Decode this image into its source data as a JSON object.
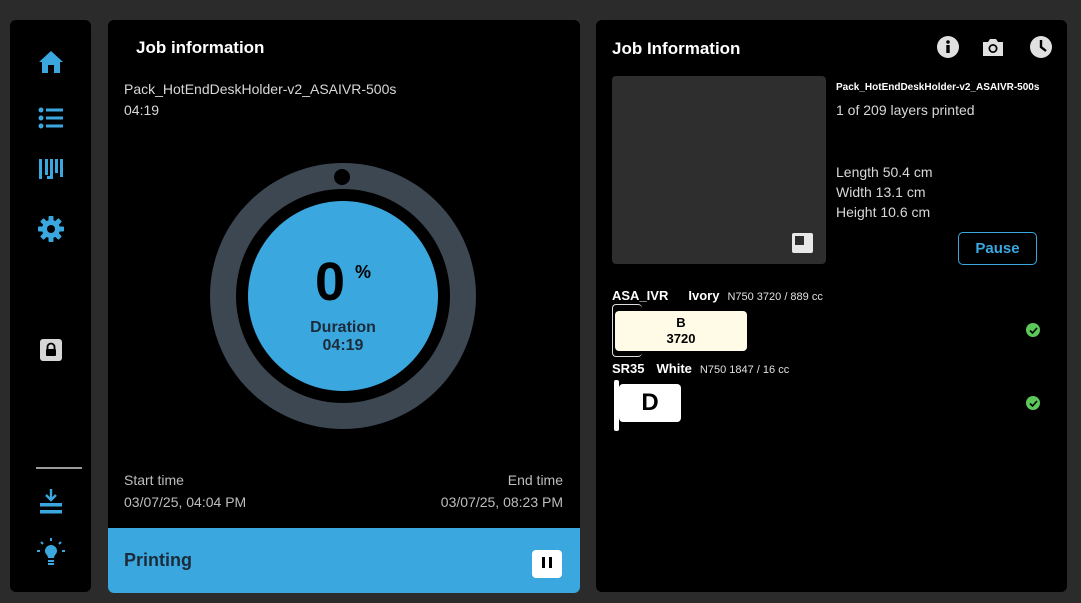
{
  "sidebar": {
    "items": [
      {
        "icon": "home-icon"
      },
      {
        "icon": "list-icon"
      },
      {
        "icon": "material-icon"
      },
      {
        "icon": "gear-icon"
      },
      {
        "icon": "lock-icon"
      },
      {
        "icon": "unload-icon"
      },
      {
        "icon": "lightbulb-icon"
      }
    ]
  },
  "left": {
    "title": "Job information",
    "file_name": "Pack_HotEndDeskHolder-v2_ASAIVR-500s",
    "elapsed": "04:19",
    "progress_value": "0",
    "progress_unit": "%",
    "progress_fraction": 0,
    "duration_label": "Duration",
    "duration_value": "04:19",
    "start_label": "Start time",
    "start_value": "03/07/25, 04:04 PM",
    "end_label": "End time",
    "end_value": "03/07/25, 08:23 PM",
    "status": "Printing"
  },
  "right": {
    "title": "Job Information",
    "file_name": "Pack_HotEndDeskHolder-v2_ASAIVR-500s",
    "layers": "1 of 209 layers printed",
    "length": "Length 50.4 cm",
    "width": "Width 13.1 cm",
    "height": "Height 10.6 cm",
    "pause_label": "Pause",
    "materials": [
      {
        "name": "ASA_IVR",
        "color": "Ivory",
        "detail": "N750 3720 / 889 cc",
        "slot": "B",
        "code": "3720"
      },
      {
        "name": "SR35",
        "color": "White",
        "detail": "N750 1847 / 16 cc",
        "slot": "D"
      }
    ]
  },
  "colors": {
    "accent": "#3aa8df",
    "ring": "#3c4752",
    "ok": "#5cc85a"
  }
}
